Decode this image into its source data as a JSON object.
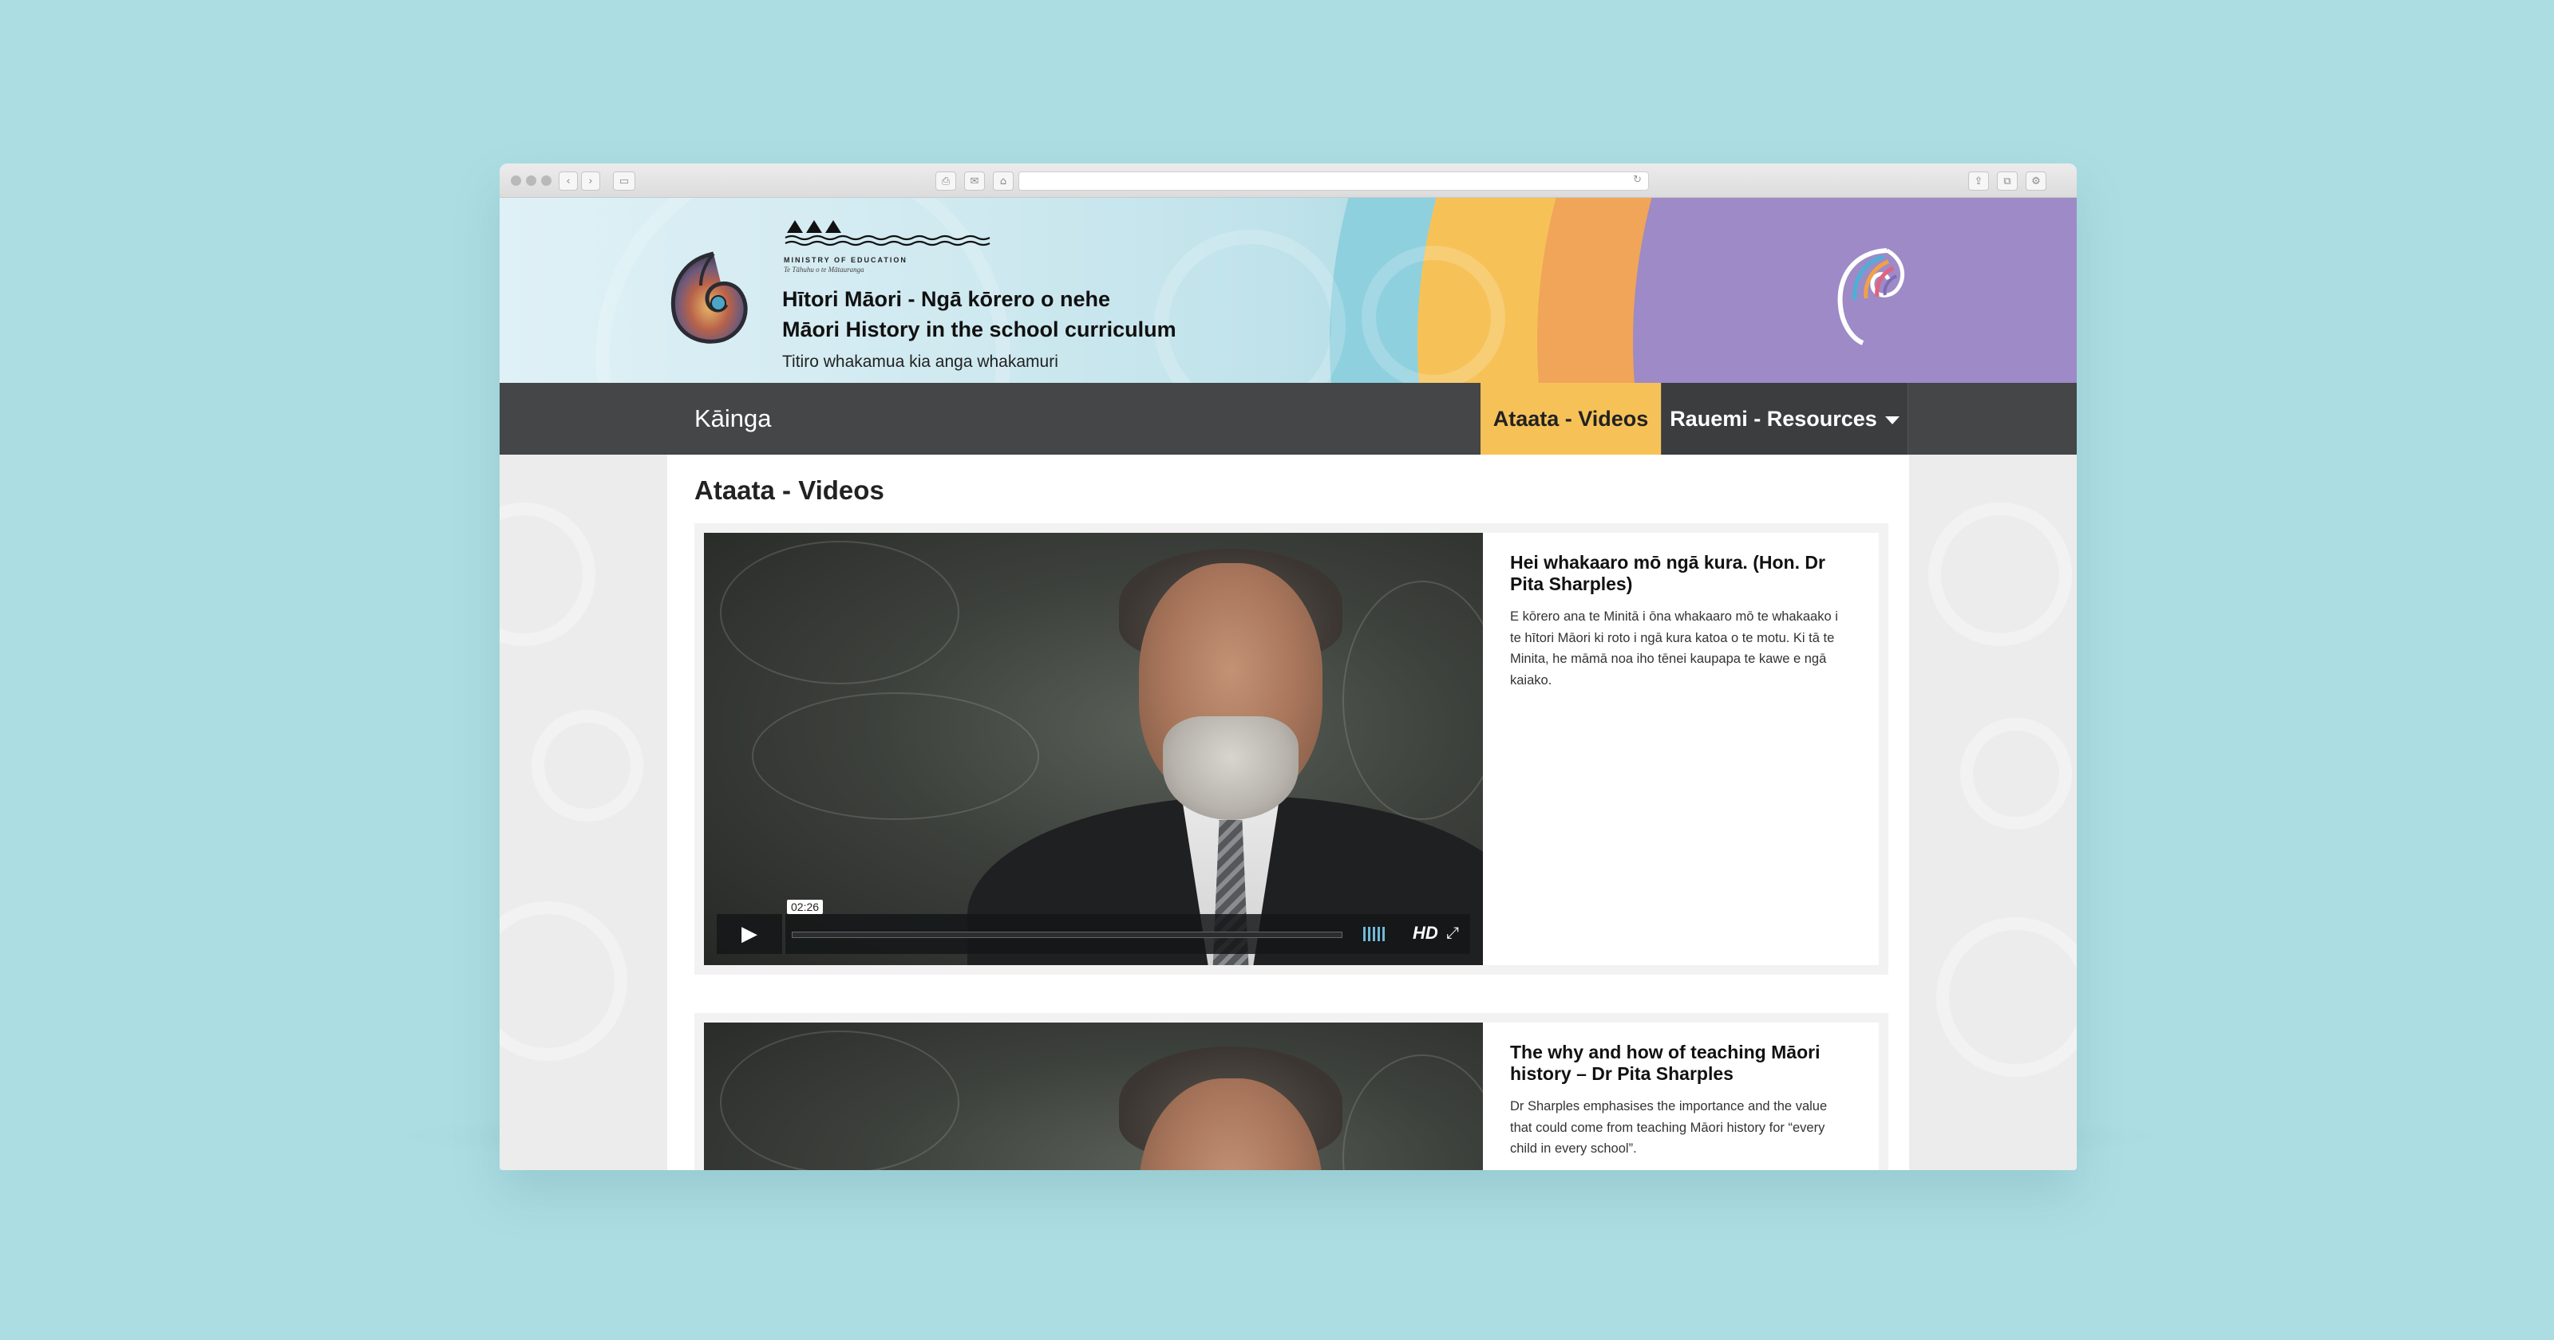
{
  "header": {
    "ministry_name": "MINISTRY OF EDUCATION",
    "ministry_sub": "Te Tāhuhu o te Mātauranga",
    "site_title_line1": "Hītori Māori - Ngā kōrero o nehe",
    "site_title_line2": "Māori History in the school curriculum",
    "tagline": "Titiro whakamua kia anga whakamuri"
  },
  "nav": {
    "home": "Kāinga",
    "videos": "Ataata - Videos",
    "resources": "Rauemi - Resources"
  },
  "page": {
    "title": "Ataata - Videos"
  },
  "videos": [
    {
      "title": "Hei whakaaro mō ngā kura. (Hon. Dr Pita Sharples)",
      "description": "E kōrero ana te Minitā i ōna whakaaro mō te whakaako i te hītori Māori ki roto i ngā kura katoa o te motu.   Ki tā te Minita, he māmā noa iho tēnei kaupapa te kawe e ngā kaiako.",
      "duration": "02:26",
      "quality": "HD"
    },
    {
      "title": "The why and how of teaching Māori history – Dr Pita Sharples",
      "description": "Dr Sharples emphasises the importance and the value that could come from teaching Māori history for “every child in every school”."
    }
  ],
  "colors": {
    "background": "#acdde3",
    "nav_bg": "#444648",
    "accent_yellow": "#f6c258",
    "accent_teal": "#8fd0df",
    "accent_purple": "#9d8ac6",
    "accent_orange": "#f1a559"
  },
  "icons": {
    "play": "play-icon",
    "fullscreen": "fullscreen-icon",
    "volume": "volume-icon",
    "dropdown": "chevron-down-icon"
  }
}
